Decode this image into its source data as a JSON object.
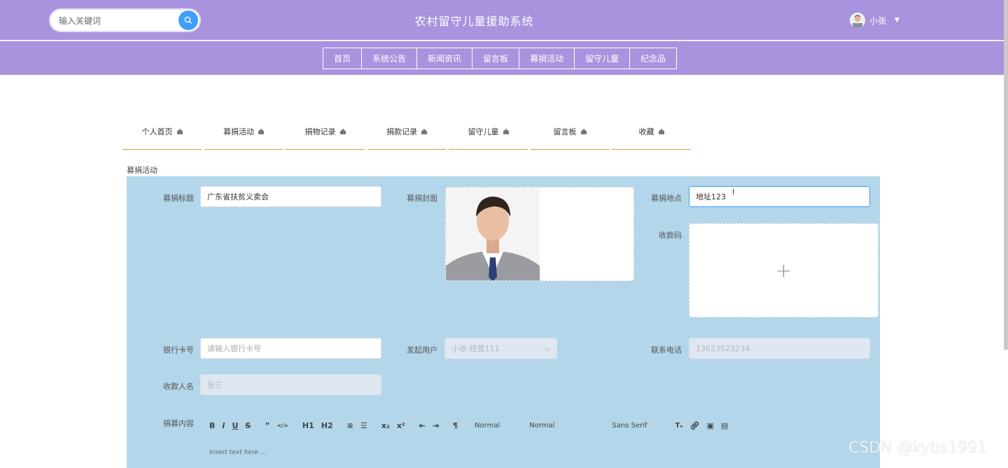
{
  "header": {
    "search_placeholder": "输入关键词",
    "site_title": "农村留守儿童援助系统",
    "user_name": "小张"
  },
  "nav": {
    "items": [
      "首页",
      "系统公告",
      "新闻资讯",
      "留言板",
      "募捐活动",
      "留守儿童",
      "纪念品"
    ]
  },
  "profile_tabs": [
    "个人首页",
    "募捐活动",
    "捐物记录",
    "捐款记录",
    "留守儿童",
    "留言板",
    "收藏"
  ],
  "section_label": "募捐活动",
  "form": {
    "title_label": "募捐标题",
    "title_value": "广东省扶贫义卖会",
    "cover_label": "募捐封面",
    "location_label": "募捐地点",
    "location_value": "地址123",
    "qrcode_label": "收款码",
    "card_label": "银行卡号",
    "card_placeholder": "请输入银行卡号",
    "publisher_label": "发起用户",
    "publisher_value": "小张 经营111",
    "phone_label": "联系电话",
    "phone_value": "13623523234",
    "account_label": "收款人名",
    "account_value": "张三",
    "content_label": "捐募内容"
  },
  "editor": {
    "buttons": [
      "B",
      "I",
      "U",
      "S",
      "”",
      "</>",
      "H1",
      "H2",
      "≡",
      "☰",
      "x₂",
      "x²",
      "⇤",
      "⇥",
      "¶"
    ],
    "size_select": "Normal",
    "header_select": "Normal",
    "font_select": "Sans Serif",
    "placeholder": "Insert text here ..."
  },
  "watermark": "CSDN @kybs1991",
  "colors": {
    "header_bg": "#a992de",
    "panel_bg": "#b3d6ea",
    "accent": "#409eff",
    "tab_underline": "#c9a44a"
  }
}
